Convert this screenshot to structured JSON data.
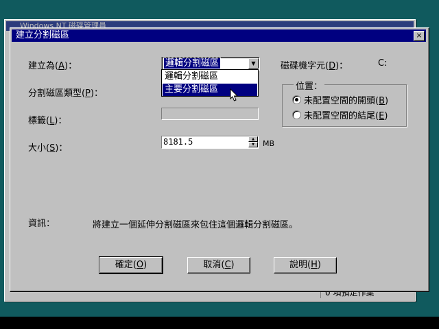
{
  "background_window": {
    "title": "Windows NT 磁碟管理員",
    "status": "0 項預定作業"
  },
  "dialog": {
    "title": "建立分割磁區",
    "close_glyph": "×",
    "create_as": {
      "label": "建立為",
      "hotkey": "A",
      "value": "邏輯分割磁區",
      "options": [
        "邏輯分割磁區",
        "主要分割磁區"
      ],
      "highlighted": "主要分割磁區"
    },
    "drive_letter": {
      "label": "磁碟機字元",
      "hotkey": "D",
      "value": "C:"
    },
    "partition_type": {
      "label": "分割磁區類型",
      "hotkey": "P"
    },
    "volume_label": {
      "label": "標籤",
      "hotkey": "L",
      "value": ""
    },
    "size": {
      "label": "大小",
      "hotkey": "S",
      "value": "8181.5",
      "unit": "MB"
    },
    "position": {
      "title": "位置",
      "options": [
        {
          "label": "未配置空間的開頭",
          "hotkey": "B",
          "selected": true
        },
        {
          "label": "未配置空間的結尾",
          "hotkey": "E",
          "selected": false
        }
      ]
    },
    "info": {
      "label": "資訊：",
      "text": "將建立一個延伸分割磁區來包住這個邏輯分割磁區。"
    },
    "buttons": {
      "ok": {
        "label": "確定",
        "hotkey": "O"
      },
      "cancel": {
        "label": "取消",
        "hotkey": "C"
      },
      "help": {
        "label": "說明",
        "hotkey": "H"
      }
    }
  },
  "colors": {
    "desktop": "#105a5e",
    "titlebar": "#000080",
    "face": "#c0c0c0",
    "highlight": "#000080"
  }
}
